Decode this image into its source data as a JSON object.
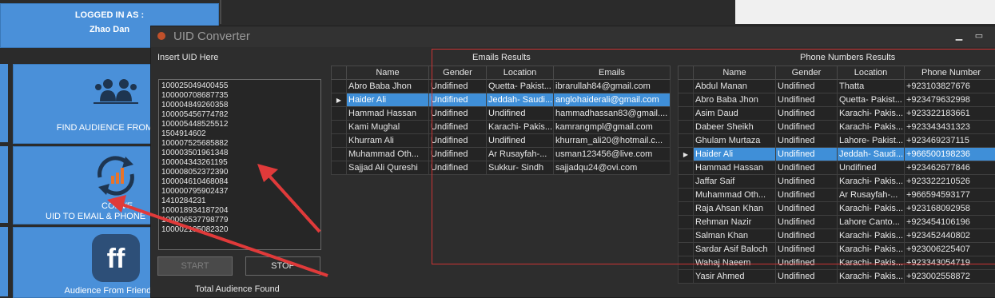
{
  "login": {
    "label": "LOGGED IN AS :",
    "user": "Zhao Dan"
  },
  "tiles": [
    {
      "label": "FIND AUDIENCE FROM GRO",
      "icon": "users-group-icon"
    },
    {
      "label1": "CONVE",
      "label2": "UID TO EMAIL & PHONE",
      "icon": "convert-cycle-icon"
    },
    {
      "label": "Audience From Friends Of",
      "icon": "friends-network-icon"
    }
  ],
  "window": {
    "title": "UID Converter"
  },
  "insert_label": "Insert UID Here",
  "uid_text": "100025049400455\n100000708687735\n100004849260358\n100005456774782\n100005448525512\n1504914602\n100007525685882\n100003501961348\n100004343261195\n100008052372390\n100004610468084\n100000795902437\n1410284231\n100018934187204\n100006537798779\n100002105082320",
  "buttons": {
    "start": "START",
    "stop": "STOP"
  },
  "total_label": "Total Audience Found",
  "emails": {
    "title": "Emails Results",
    "columns": [
      "Name",
      "Gender",
      "Location",
      "Emails"
    ],
    "rows": [
      [
        "Abro Baba Jhon",
        "Undifined",
        "Quetta- Pakist...",
        "ibrarullah84@gmail.com"
      ],
      [
        "Haider Ali",
        "Undifined",
        "Jeddah- Saudi...",
        "anglohaiderali@gmail.com"
      ],
      [
        "Hammad Hassan",
        "Undifined",
        "Undifined",
        "hammadhassan83@gmail...."
      ],
      [
        "Kami Mughal",
        "Undifined",
        "Karachi- Pakis...",
        "kamrangmpl@gmail.com"
      ],
      [
        "Khurram Ali",
        "Undifined",
        "Undifined",
        "khurram_ali20@hotmail.c..."
      ],
      [
        "Muhammad Oth...",
        "Undifined",
        "Ar Rusayfah-...",
        "usman123456@live.com"
      ],
      [
        "Sajjad Ali Qureshi",
        "Undifined",
        "Sukkur- Sindh",
        "sajjadqu24@ovi.com"
      ]
    ],
    "selected_row": 1
  },
  "phones": {
    "title": "Phone Numbers Results",
    "columns": [
      "Name",
      "Gender",
      "Location",
      "Phone Number"
    ],
    "rows": [
      [
        "Abdul Manan",
        "Undifined",
        "Thatta",
        "+923103827676"
      ],
      [
        "Abro Baba Jhon",
        "Undifined",
        "Quetta- Pakist...",
        "+923479632998"
      ],
      [
        "Asim Daud",
        "Undifined",
        "Karachi- Pakis...",
        "+923322183661"
      ],
      [
        "Dabeer Sheikh",
        "Undifined",
        "Karachi- Pakis...",
        "+923343431323"
      ],
      [
        "Ghulam Murtaza",
        "Undifined",
        "Lahore- Pakist...",
        "+923469237115"
      ],
      [
        "Haider Ali",
        "Undifined",
        "Jeddah- Saudi...",
        "+966500198236"
      ],
      [
        "Hammad Hassan",
        "Undifined",
        "Undifined",
        "+923462677846"
      ],
      [
        "Jaffar Saif",
        "Undifined",
        "Karachi- Pakis...",
        "+923322210526"
      ],
      [
        "Muhammad Oth...",
        "Undifined",
        "Ar Rusayfah-...",
        "+966594593177"
      ],
      [
        "Raja Ahsan Khan",
        "Undifined",
        "Karachi- Pakis...",
        "+923168092958"
      ],
      [
        "Rehman Nazir",
        "Undifined",
        "Lahore Canto...",
        "+923454106196"
      ],
      [
        "Salman Khan",
        "Undifined",
        "Karachi- Pakis...",
        "+923452440802"
      ],
      [
        "Sardar Asif Baloch",
        "Undifined",
        "Karachi- Pakis...",
        "+923006225407"
      ],
      [
        "Wahaj Naeem",
        "Undifined",
        "Karachi- Pakis...",
        "+923343054719"
      ],
      [
        "Yasir Ahmed",
        "Undifined",
        "Karachi- Pakis...",
        "+923002558872"
      ]
    ],
    "selected_row": 5
  },
  "colors": {
    "tile_blue": "#4a90d9",
    "selection_blue": "#3f8fd8",
    "annotation_red": "#e03a3a"
  }
}
